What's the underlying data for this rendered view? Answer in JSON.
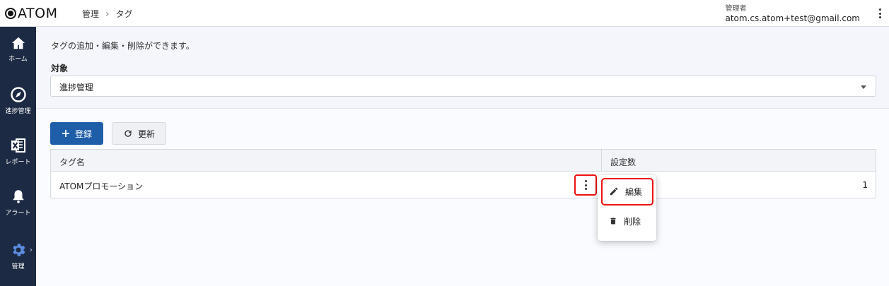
{
  "header": {
    "logo_text": "ATOM",
    "breadcrumb": [
      "管理",
      "タグ"
    ],
    "user_role": "管理者",
    "user_email": "atom.cs.atom+test@gmail.com"
  },
  "sidebar": {
    "items": [
      {
        "label": "ホーム",
        "icon": "home-icon"
      },
      {
        "label": "進捗管理",
        "icon": "progress-compass-icon"
      },
      {
        "label": "レポート",
        "icon": "excel-report-icon"
      },
      {
        "label": "アラート",
        "icon": "bell-icon"
      },
      {
        "label": "管理",
        "icon": "gear-icon",
        "active": true
      }
    ]
  },
  "main": {
    "description": "タグの追加・編集・削除ができます。",
    "target_label": "対象",
    "target_value": "進捗管理",
    "add_button": "登録",
    "refresh_button": "更新",
    "table": {
      "headers": [
        "タグ名",
        "設定数"
      ],
      "rows": [
        {
          "name": "ATOMプロモーション",
          "count": "1"
        }
      ]
    },
    "row_menu": {
      "edit": "編集",
      "delete": "削除"
    }
  },
  "colors": {
    "sidebar_bg": "#1c2a43",
    "primary": "#1e5ea8",
    "highlight": "#ee1111"
  }
}
